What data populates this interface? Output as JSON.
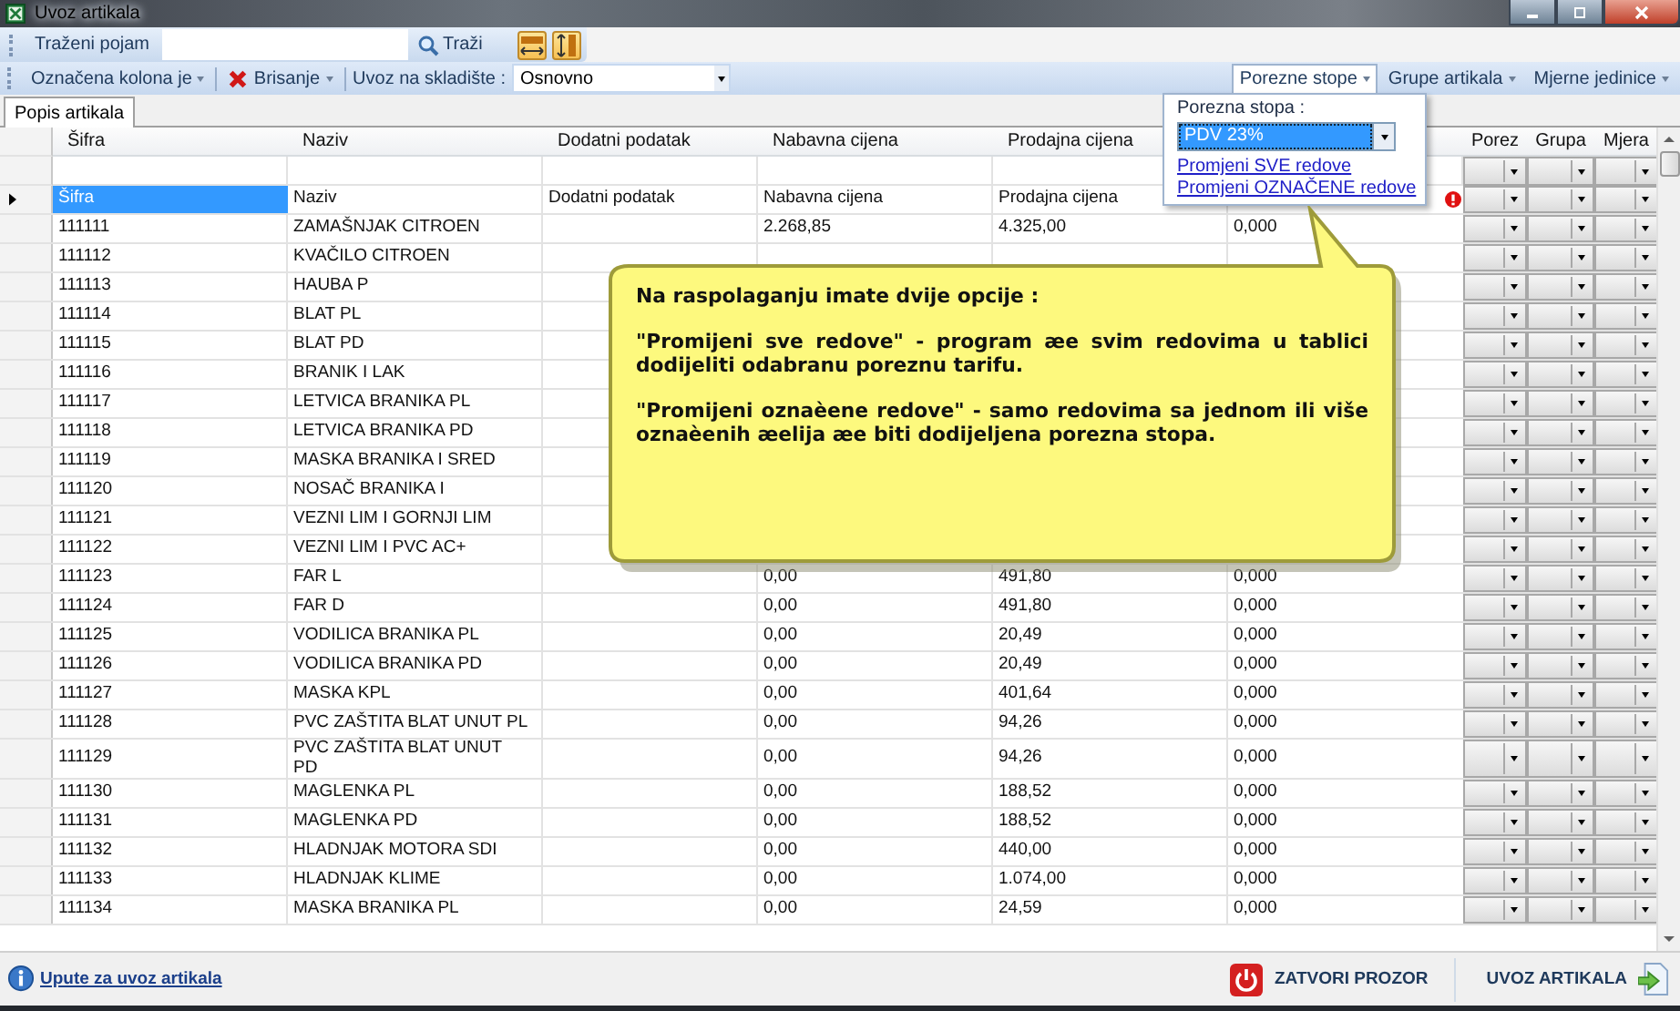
{
  "window": {
    "title": "Uvoz artikala"
  },
  "search": {
    "label": "Traženi pojam",
    "button": "Traži"
  },
  "toolbar": {
    "items": [
      {
        "kind": "menu",
        "label": "Označena kolona je"
      },
      {
        "kind": "delete",
        "label": "Brisanje"
      },
      {
        "kind": "combo",
        "label": "Uvoz na skladište :",
        "value": "Osnovno"
      }
    ],
    "menus": [
      {
        "label": "Porezne stope",
        "selected": true
      },
      {
        "label": "Grupe artikala",
        "selected": false
      },
      {
        "label": "Mjerne jedinice",
        "selected": false
      }
    ]
  },
  "tabs": [
    {
      "label": "Popis artikala",
      "selected": true
    }
  ],
  "table": {
    "columns": [
      {
        "kind": "text",
        "label": "Šifra"
      },
      {
        "kind": "text",
        "label": "Naziv"
      },
      {
        "kind": "text",
        "label": "Dodatni podatak"
      },
      {
        "kind": "text",
        "label": "Nabavna cijena"
      },
      {
        "kind": "text",
        "label": "Prodajna cijena"
      },
      {
        "kind": "text"
      },
      {
        "kind": "combo",
        "label": "Porez"
      },
      {
        "kind": "combo",
        "label": "Grupa"
      },
      {
        "kind": "combo",
        "label": "Mjera"
      }
    ],
    "rows": [
      {
        "cells": [
          "Šifra",
          "Naziv",
          "Dodatni podatak",
          "Nabavna cijena",
          "Prodajna cijena",
          null
        ],
        "selected": true,
        "error": true
      },
      {
        "cells": [
          "111111",
          "ZAMAŠNJAK CITROEN",
          null,
          "2.268,85",
          "4.325,00",
          "0,000"
        ],
        "selected": false,
        "error": false
      },
      {
        "cells": [
          "111112",
          "KVAČILO CITROEN",
          null,
          null,
          null,
          null
        ],
        "selected": false,
        "error": false
      },
      {
        "cells": [
          "111113",
          "HAUBA P",
          null,
          null,
          null,
          null
        ],
        "selected": false,
        "error": false
      },
      {
        "cells": [
          "111114",
          "BLAT PL",
          null,
          null,
          null,
          null
        ],
        "selected": false,
        "error": false
      },
      {
        "cells": [
          "111115",
          "BLAT PD",
          null,
          null,
          null,
          null
        ],
        "selected": false,
        "error": false
      },
      {
        "cells": [
          "111116",
          "BRANIK I LAK",
          null,
          null,
          null,
          null
        ],
        "selected": false,
        "error": false
      },
      {
        "cells": [
          "111117",
          "LETVICA BRANIKA PL",
          null,
          null,
          null,
          null
        ],
        "selected": false,
        "error": false
      },
      {
        "cells": [
          "111118",
          "LETVICA BRANIKA PD",
          null,
          null,
          null,
          null
        ],
        "selected": false,
        "error": false
      },
      {
        "cells": [
          "111119",
          "MASKA BRANIKA I SRED",
          null,
          null,
          null,
          null
        ],
        "selected": false,
        "error": false
      },
      {
        "cells": [
          "111120",
          "NOSAČ BRANIKA I",
          null,
          null,
          null,
          null
        ],
        "selected": false,
        "error": false
      },
      {
        "cells": [
          "111121",
          "VEZNI LIM I GORNJI LIM",
          null,
          null,
          null,
          null
        ],
        "selected": false,
        "error": false
      },
      {
        "cells": [
          "111122",
          "VEZNI LIM I PVC AC+",
          null,
          null,
          null,
          null
        ],
        "selected": false,
        "error": false
      },
      {
        "cells": [
          "111123",
          "FAR L",
          null,
          "0,00",
          "491,80",
          "0,000"
        ],
        "selected": false,
        "error": false
      },
      {
        "cells": [
          "111124",
          "FAR D",
          null,
          "0,00",
          "491,80",
          "0,000"
        ],
        "selected": false,
        "error": false
      },
      {
        "cells": [
          "111125",
          "VODILICA BRANIKA PL",
          null,
          "0,00",
          "20,49",
          "0,000"
        ],
        "selected": false,
        "error": false
      },
      {
        "cells": [
          "111126",
          "VODILICA BRANIKA PD",
          null,
          "0,00",
          "20,49",
          "0,000"
        ],
        "selected": false,
        "error": false
      },
      {
        "cells": [
          "111127",
          "MASKA KPL",
          null,
          "0,00",
          "401,64",
          "0,000"
        ],
        "selected": false,
        "error": false
      },
      {
        "cells": [
          "111128",
          "PVC ZAŠTITA BLAT UNUT PL",
          null,
          "0,00",
          "94,26",
          "0,000"
        ],
        "selected": false,
        "error": false
      },
      {
        "cells": [
          "111129",
          "PVC ZAŠTITA BLAT UNUT\nPD",
          null,
          "0,00",
          "94,26",
          "0,000"
        ],
        "selected": false,
        "error": false
      },
      {
        "cells": [
          "111130",
          "MAGLENKA PL",
          null,
          "0,00",
          "188,52",
          "0,000"
        ],
        "selected": false,
        "error": false
      },
      {
        "cells": [
          "111131",
          "MAGLENKA PD",
          null,
          "0,00",
          "188,52",
          "0,000"
        ],
        "selected": false,
        "error": false
      },
      {
        "cells": [
          "111132",
          "HLADNJAK MOTORA SDI",
          null,
          "0,00",
          "440,00",
          "0,000"
        ],
        "selected": false,
        "error": false
      },
      {
        "cells": [
          "111133",
          "HLADNJAK KLIME",
          null,
          "0,00",
          "1.074,00",
          "0,000"
        ],
        "selected": false,
        "error": false
      },
      {
        "cells": [
          "111134",
          "MASKA BRANIKA PL",
          null,
          "0,00",
          "24,59",
          "0,000"
        ],
        "selected": false,
        "error": false
      }
    ]
  },
  "tax_popup": {
    "label": "Porezna stopa :",
    "value": "PDV 23%",
    "links": [
      "Promjeni SVE redove",
      "Promjeni OZNAČENE redove"
    ]
  },
  "callout": {
    "paragraphs": [
      "Na raspolaganju imate dvije opcije :",
      "\"Promijeni sve redove\" - program æe svim redovima u tablici dodijeliti odabranu poreznu tarifu.",
      "\"Promijeni oznaèene redove\" - samo redovima sa jednom ili više oznaèenih æelija æe biti dodijeljena porezna stopa."
    ]
  },
  "footer": {
    "help_link": "Upute za uvoz artikala",
    "buttons": [
      {
        "kind": "close",
        "label": "ZATVORI PROZOR"
      },
      {
        "kind": "import",
        "label": "UVOZ ARTIKALA"
      }
    ]
  }
}
